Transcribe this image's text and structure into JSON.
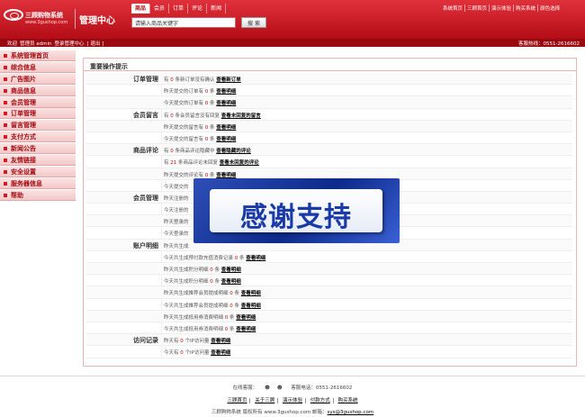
{
  "header": {
    "logo_name": "三顾购物系统",
    "logo_url": "www.3gushop.com",
    "admin_title": "管理中心",
    "search_tabs": [
      "商品",
      "会员",
      "订单",
      "评论",
      "新闻"
    ],
    "search_placeholder": "请输入商品关键字",
    "search_button": "搜 索",
    "top_links": [
      "系统首页",
      "三顾首页",
      "演示体验",
      "购买系统",
      "颜色选择"
    ]
  },
  "info_bar": {
    "welcome": "欢迎",
    "user": "管理员 admin",
    "login_to": "登录管理中心",
    "logout": "[ 退出 ]",
    "hotline": "客服热线：0551-2616602"
  },
  "sidebar": {
    "items": [
      "系统管理首页",
      "综合信息",
      "广告图片",
      "商品信息",
      "会员管理",
      "订单管理",
      "留言管理",
      "支付方式",
      "新闻公告",
      "友情链接",
      "安全设置",
      "服务器信息",
      "帮助"
    ]
  },
  "main": {
    "title": "重要操作提示",
    "rows": [
      {
        "cat": "订单管理",
        "pre": "有",
        "num": "0",
        "post": "条新订单没有确认",
        "link": "查看新订单"
      },
      {
        "cat": "",
        "pre": "昨天提交的订单有",
        "num": "0",
        "post": "条",
        "link": "查看明细"
      },
      {
        "cat": "",
        "pre": "今天提交的订单有",
        "num": "0",
        "post": "条",
        "link": "查看明细"
      },
      {
        "cat": "会员留言",
        "pre": "有",
        "num": "0",
        "post": "条会员留言没有回复",
        "link": "查看未回复的留言"
      },
      {
        "cat": "",
        "pre": "昨天提交的留言有",
        "num": "0",
        "post": "条",
        "link": "查看明细"
      },
      {
        "cat": "",
        "pre": "今天提交的留言有",
        "num": "0",
        "post": "条",
        "link": "查看明细"
      },
      {
        "cat": "商品评论",
        "pre": "有",
        "num": "0",
        "post": "条商品评论隐藏中",
        "link": "查看隐藏的评论"
      },
      {
        "cat": "",
        "pre": "有",
        "num": "21",
        "post": "条商品评论未回复",
        "link": "查看未回复的评论"
      },
      {
        "cat": "",
        "pre": "昨天提交的评论有",
        "num": "0",
        "post": "条",
        "link": "查看明细"
      },
      {
        "cat": "",
        "pre": "今天提交的",
        "num": "",
        "post": "",
        "link": ""
      },
      {
        "cat": "会员管理",
        "pre": "昨天注册的",
        "num": "",
        "post": "",
        "link": ""
      },
      {
        "cat": "",
        "pre": "今天注册的",
        "num": "",
        "post": "",
        "link": ""
      },
      {
        "cat": "",
        "pre": "昨天登录的",
        "num": "",
        "post": "",
        "link": ""
      },
      {
        "cat": "",
        "pre": "今天登录的",
        "num": "",
        "post": "",
        "link": ""
      },
      {
        "cat": "账户明细",
        "pre": "昨天共生成",
        "num": "",
        "post": "",
        "link": ""
      },
      {
        "cat": "",
        "pre": "今天共生成预付款充值消费记录",
        "num": "0",
        "post": "条",
        "link": "查看明细"
      },
      {
        "cat": "",
        "pre": "昨天共生成积分明细",
        "num": "0",
        "post": "条",
        "link": "查看明细"
      },
      {
        "cat": "",
        "pre": "今天共生成积分明细",
        "num": "0",
        "post": "条",
        "link": "查看明细"
      },
      {
        "cat": "",
        "pre": "昨天共生成推荐会员提成明细",
        "num": "0",
        "post": "条",
        "link": "查看明细"
      },
      {
        "cat": "",
        "pre": "今天共生成推荐会员提成明细",
        "num": "0",
        "post": "条",
        "link": "查看明细"
      },
      {
        "cat": "",
        "pre": "昨天共生成抵用券消费明细",
        "num": "0",
        "post": "条",
        "link": "查看明细"
      },
      {
        "cat": "",
        "pre": "今天共生成抵用券消费明细",
        "num": "0",
        "post": "条",
        "link": "查看明细"
      },
      {
        "cat": "访问记录",
        "pre": "昨天有",
        "num": "0",
        "post": "个IP访问量",
        "link": "查看明细"
      },
      {
        "cat": "",
        "pre": "今天有",
        "num": "0",
        "post": "个IP访问量",
        "link": "查看明细"
      }
    ]
  },
  "banner": {
    "text": "感谢支持"
  },
  "footer": {
    "online_label": "在线客服：",
    "service_phone": "客服电话：0551-2616602",
    "links": [
      "三顾首页",
      "关于三顾",
      "演示体验",
      "付款方式",
      "购买系统"
    ],
    "copyright": "三顾购物系统 版权所有 www.3gushop.com 邮箱：",
    "email": "sys@3gushop.com"
  }
}
